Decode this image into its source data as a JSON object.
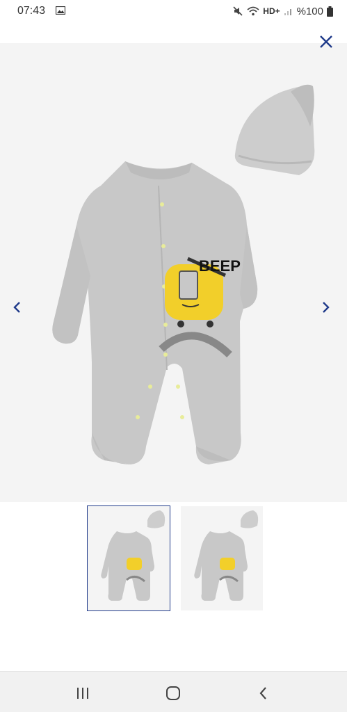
{
  "status_bar": {
    "time": "07:43",
    "network": "HD+",
    "battery": "%100"
  },
  "colors": {
    "accent": "#1f3a8a",
    "image_bg": "#f4f4f4",
    "fabric": "#c9c9c9",
    "print_yellow": "#f2cf2a"
  },
  "icons": {
    "close": "close-icon",
    "prev": "chevron-left-icon",
    "next": "chevron-right-icon"
  },
  "thumbnails": [
    {
      "selected": true
    },
    {
      "selected": false
    }
  ],
  "product_print": {
    "text": "BEEP"
  }
}
